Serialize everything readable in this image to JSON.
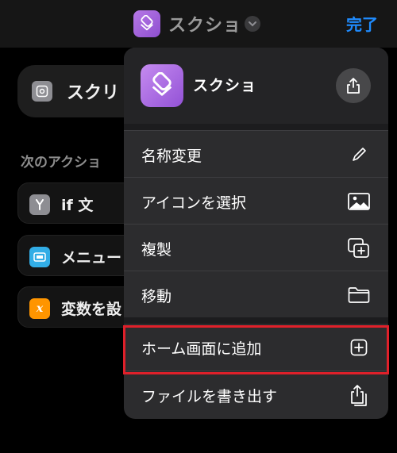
{
  "navbar": {
    "title": "スクショ",
    "done_label": "完了",
    "app_icon": "layers-icon",
    "chevron_icon": "chevron-down-icon"
  },
  "background": {
    "shortcut_label": "スクリ",
    "shortcut_icon": "screenshot-icon",
    "section_label": "次のアクショ",
    "rows": [
      {
        "label": "if 文",
        "icon": "branch-icon",
        "icon_color": "#8e8e93"
      },
      {
        "label": "メニュー",
        "icon": "menu-icon",
        "icon_color": "#32ade6"
      },
      {
        "label": "変数を設",
        "icon": "variable-icon",
        "icon_glyph": "x",
        "icon_color": "#ff9500"
      }
    ]
  },
  "menu": {
    "app_name": "スクショ",
    "app_icon": "layers-icon",
    "share_icon": "share-icon",
    "items": [
      {
        "label": "名称変更",
        "icon": "pencil-icon"
      },
      {
        "label": "アイコンを選択",
        "icon": "photo-icon"
      },
      {
        "label": "複製",
        "icon": "duplicate-icon"
      },
      {
        "label": "移動",
        "icon": "folder-icon"
      },
      {
        "label": "ホーム画面に追加",
        "icon": "plus-square-icon"
      },
      {
        "label": "ファイルを書き出す",
        "icon": "export-icon"
      }
    ]
  },
  "colors": {
    "accent": "#1f8cff",
    "highlight_border": "#e0202a",
    "app_icon": "#a865e0"
  }
}
